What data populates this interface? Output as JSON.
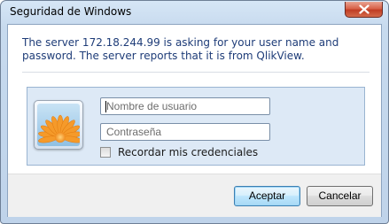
{
  "window": {
    "title": "Seguridad de Windows"
  },
  "message": {
    "text": "The server 172.18.244.99 is asking for your user name and password. The server reports that it is from QlikView."
  },
  "credentials": {
    "username_placeholder": "Nombre de usuario",
    "password_placeholder": "Contraseña",
    "remember_label": "Recordar mis credenciales",
    "remember_checked": false,
    "avatar_icon": "flower-user-tile-icon"
  },
  "buttons": {
    "ok_label": "Aceptar",
    "cancel_label": "Cancelar"
  },
  "colors": {
    "message_text": "#1e3c78",
    "panel_bg": "#dde9f6",
    "close_button": "#c03d24",
    "default_button_border": "#3c7fb1"
  }
}
